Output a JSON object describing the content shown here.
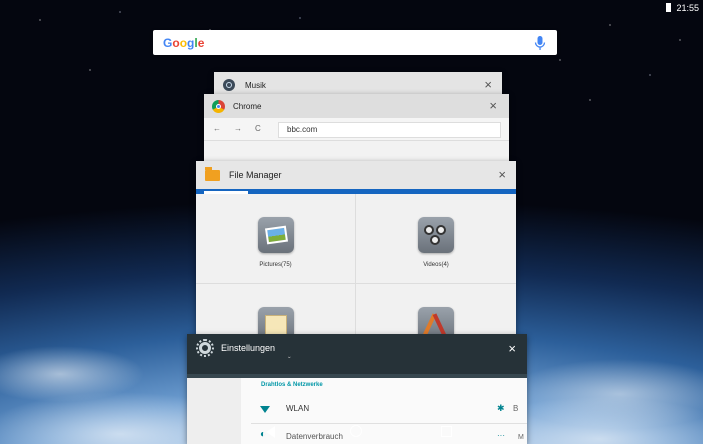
{
  "statusbar": {
    "time": "21:55"
  },
  "google_search": {
    "logo_letters": [
      "G",
      "o",
      "o",
      "g",
      "l",
      "e"
    ]
  },
  "recents": {
    "musik": {
      "title": "Musik",
      "close": "×"
    },
    "chrome": {
      "title": "Chrome",
      "close": "×",
      "back": "←",
      "forward": "→",
      "reload": "C",
      "url": "bbc.com"
    },
    "file_manager": {
      "title": "File Manager",
      "close": "×",
      "items": [
        {
          "label": "Pictures(75)",
          "icon": "pictures-icon"
        },
        {
          "label": "Videos(4)",
          "icon": "videos-icon"
        },
        {
          "label": "",
          "icon": "documents-icon"
        },
        {
          "label": "",
          "icon": "apps-icon"
        }
      ]
    },
    "settings": {
      "title": "Einstellungen",
      "close": "×",
      "chevron": "ˇ",
      "section": "Drahtlos & Netzwerke",
      "wlan": "WLAN",
      "bt_short": "B",
      "datenverbrauch": "Datenverbrauch",
      "more": "···",
      "m_short": "M"
    }
  },
  "colors": {
    "fm_accent": "#1565c0",
    "settings_header": "#263238",
    "settings_accent": "#0097a7"
  }
}
